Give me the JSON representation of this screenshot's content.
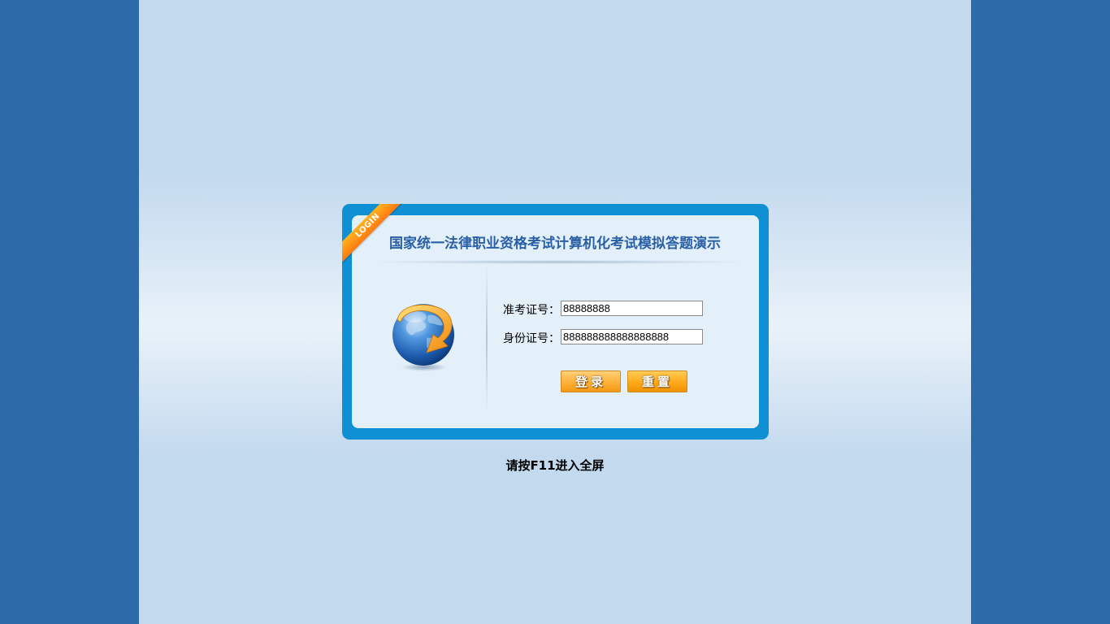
{
  "login": {
    "ribbon_text": "LOGIN",
    "title": "国家统一法律职业资格考试计算机化考试模拟答题演示",
    "exam_id_label": "准考证号：",
    "exam_id_value": "88888888",
    "id_card_label": "身份证号：",
    "id_card_value": "888888888888888888",
    "login_button": "登录",
    "reset_button": "重置"
  },
  "hint": "请按F11进入全屏",
  "colors": {
    "outer_background": "#2c6aaa",
    "page_background": "#c3d9ee",
    "box_border": "#0f8fd4",
    "box_inner": "#e3f0fa",
    "title_text": "#2a5fa5",
    "button_orange": "#ffb33d",
    "ribbon_orange": "#ff7a10"
  },
  "icons": {
    "globe": "globe-arrow-icon"
  }
}
